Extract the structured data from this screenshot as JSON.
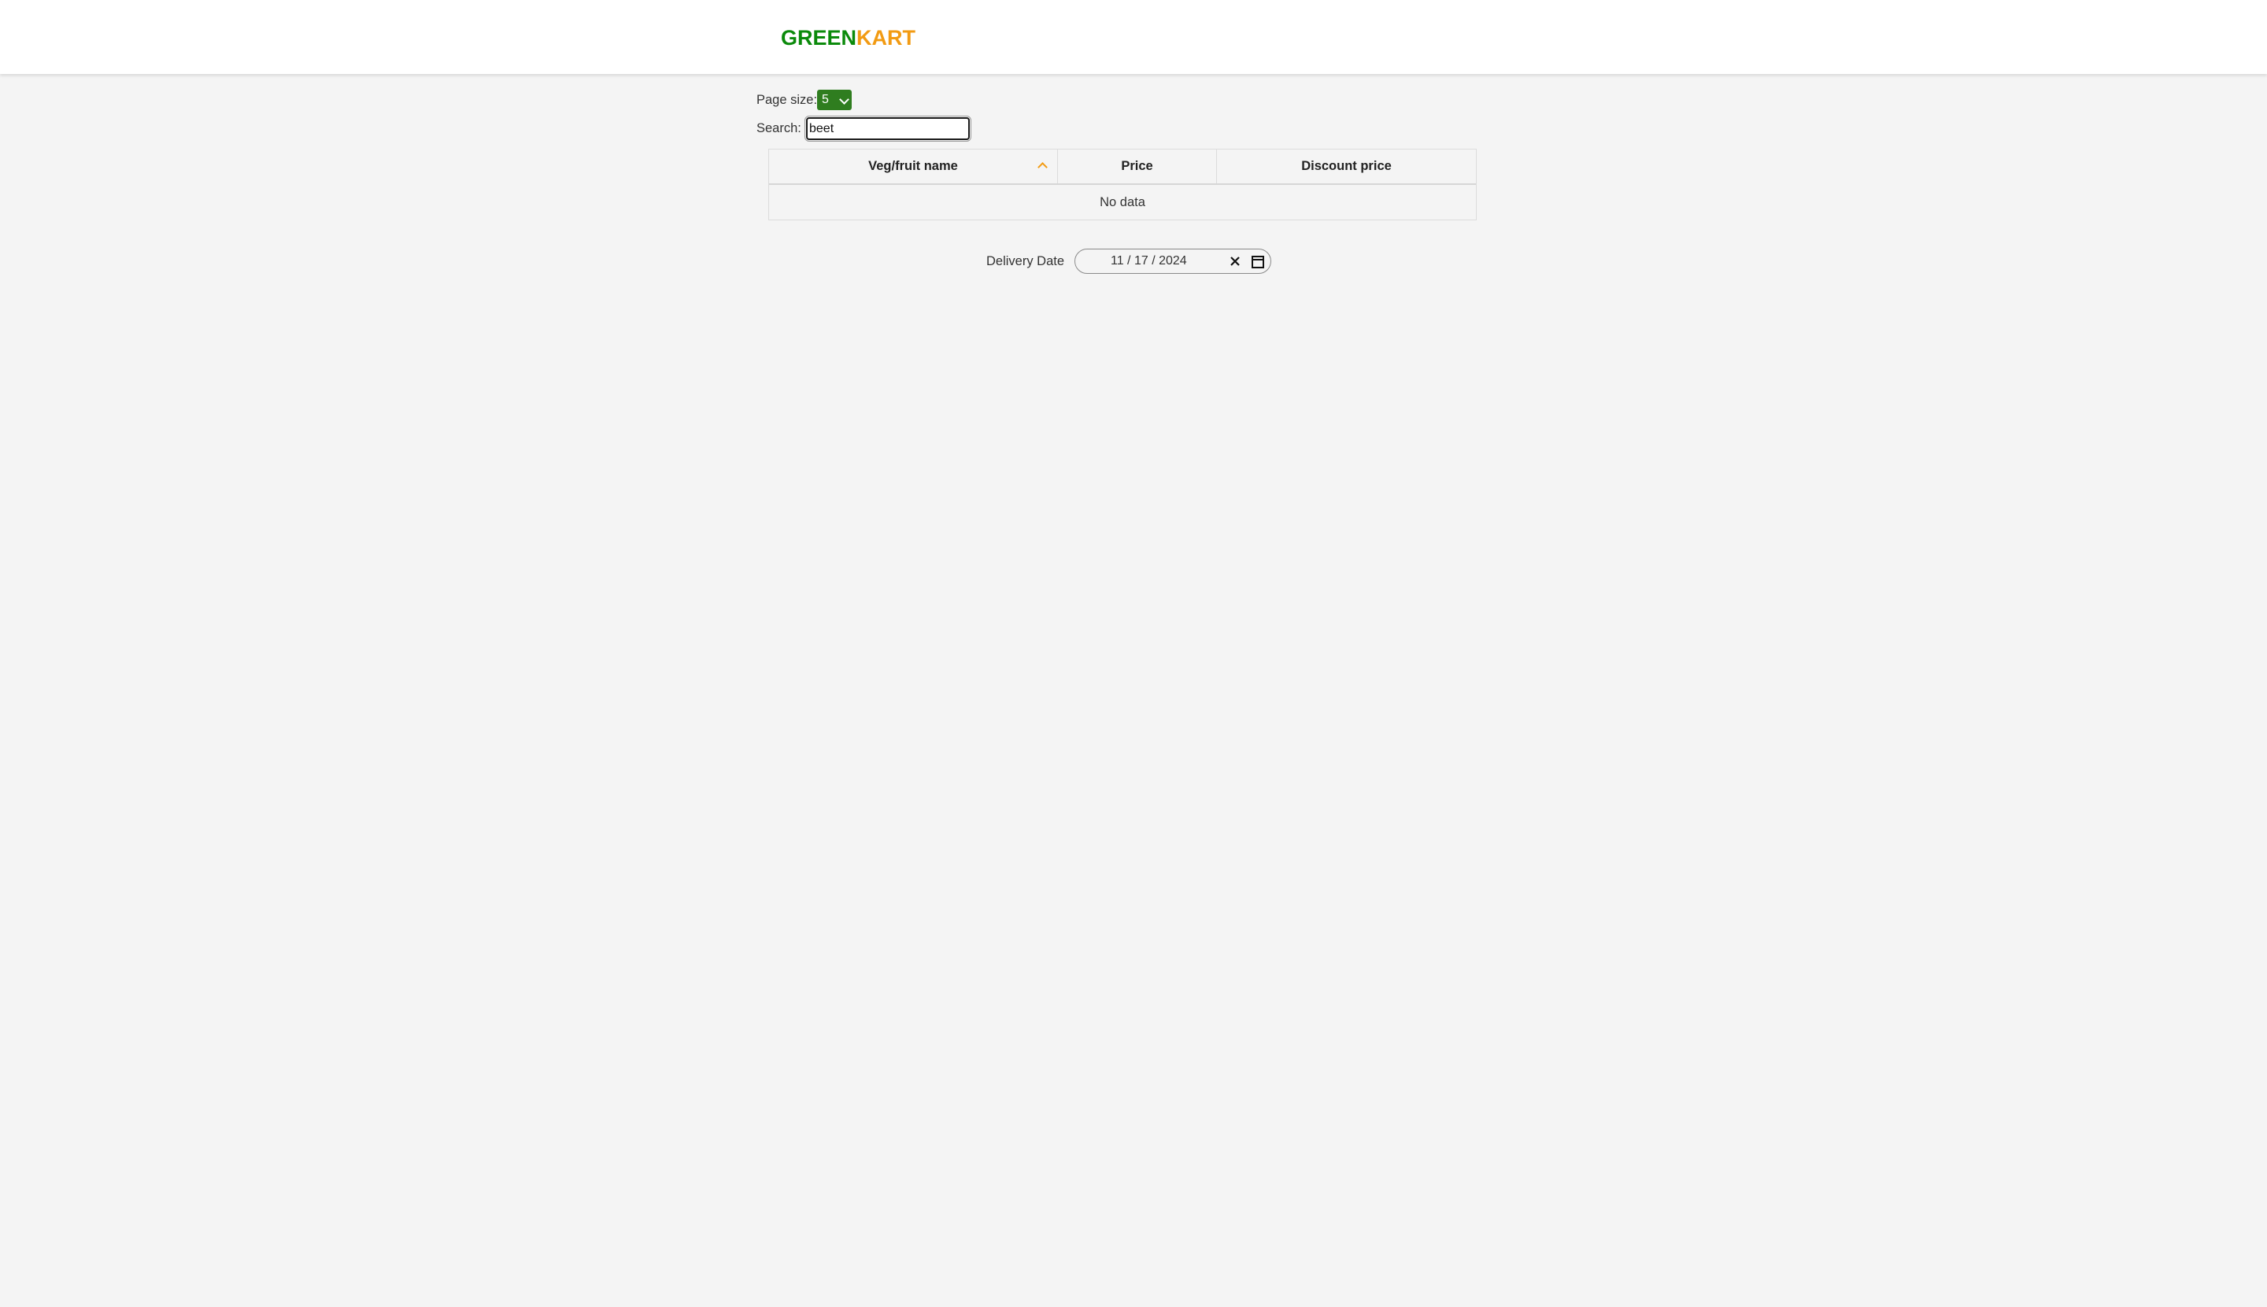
{
  "header": {
    "brand_part1": "GREEN",
    "brand_part2": "KART",
    "brand_colors": {
      "green": "#0b8a0b",
      "orange": "#f29b13"
    }
  },
  "controls": {
    "page_size_label": "Page size:",
    "page_size_value": "5",
    "search_label": "Search:",
    "search_value": "beet"
  },
  "table": {
    "columns": [
      {
        "label": "Veg/fruit name",
        "sort": "ascending"
      },
      {
        "label": "Price"
      },
      {
        "label": "Discount price"
      }
    ],
    "empty_message": "No data"
  },
  "delivery": {
    "label": "Delivery Date",
    "month": "11",
    "day": "17",
    "year": "2024",
    "date_display": "11 / 17 / 2024",
    "icons": [
      "close-icon",
      "calendar-icon"
    ]
  }
}
